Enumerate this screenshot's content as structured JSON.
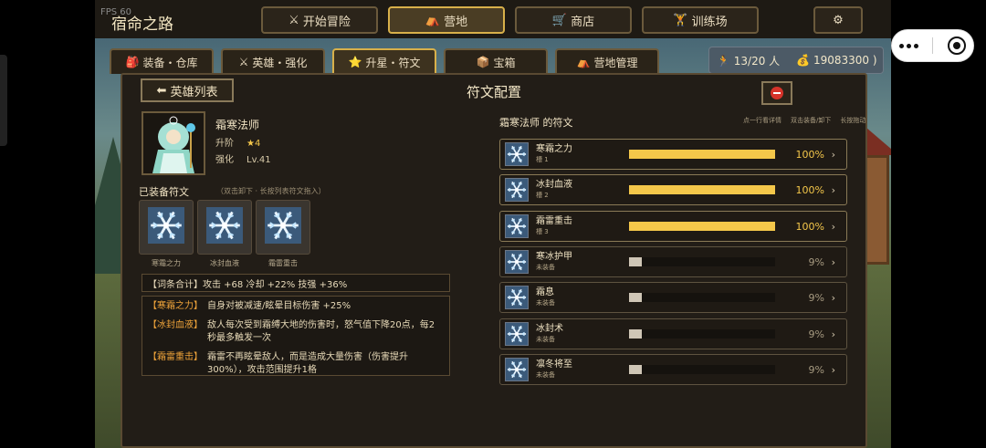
{
  "top_bar": {
    "fps": "FPS 60",
    "title": "宿命之路",
    "nav": [
      {
        "icon": "swords-icon",
        "glyph": "⚔",
        "label": "开始冒险",
        "active": false
      },
      {
        "icon": "camp-tent-icon",
        "glyph": "⛺",
        "label": "营地",
        "active": true
      },
      {
        "icon": "cart-icon",
        "glyph": "🛒",
        "label": "商店",
        "active": false
      },
      {
        "icon": "weightlifter-icon",
        "glyph": "🏋",
        "label": "训练场",
        "active": false
      }
    ],
    "settings_glyph": "⚙"
  },
  "tabs": [
    {
      "icon": "backpack-icon",
      "glyph": "🎒",
      "label": "装备・仓库",
      "active": false
    },
    {
      "icon": "swords-icon",
      "glyph": "⚔",
      "label": "英雄・强化",
      "active": false
    },
    {
      "icon": "star-upgrade-icon",
      "glyph": "⭐",
      "label": "升星・符文",
      "active": true
    },
    {
      "icon": "chest-icon",
      "glyph": "📦",
      "label": "宝箱",
      "active": false
    },
    {
      "icon": "camp-tent-icon",
      "glyph": "⛺",
      "label": "营地管理",
      "active": false
    }
  ],
  "status": {
    "people_glyph": "🏃",
    "people": "13/20 人",
    "gold_glyph": "💰",
    "gold": "19083300 )"
  },
  "panel": {
    "back_label": "英雄列表",
    "back_glyph": "⬅",
    "title": "符文配置",
    "hero": {
      "name": "霜寒法师",
      "rank_label": "升阶",
      "rank_value": "★4",
      "enhance_label": "强化",
      "enhance_value": "Lv.41"
    },
    "equipped": {
      "title": "已装备符文",
      "hint": "（双击卸下 · 长按列表符文拖入）",
      "slots": [
        {
          "label": "寒霜之力"
        },
        {
          "label": "冰封血液"
        },
        {
          "label": "霜雷重击"
        }
      ]
    },
    "summary": "【词条合计】攻击 +68    冷却 +22%    技强 +36%",
    "effects": [
      {
        "name": "【寒霜之力】",
        "text": "自身对被减速/眩晕目标伤害 +25%"
      },
      {
        "name": "【冰封血液】",
        "text": "敌人每次受到霜缚大地的伤害时，怒气值下降20点，每2秒最多触发一次"
      },
      {
        "name": "【霜雷重击】",
        "text": "霜雷不再眩晕敌人，而是造成大量伤害（伤害提升300%），攻击范围提升1格"
      }
    ],
    "rune_list": {
      "title": "霜寒法师 的符文",
      "hints": [
        "点一行看详情",
        "双击装备/卸下",
        "长按拖动"
      ],
      "items": [
        {
          "name": "寒霜之力",
          "sub": "槽 1",
          "pct": "100%",
          "fill": 1.0,
          "equipped": true
        },
        {
          "name": "冰封血液",
          "sub": "槽 2",
          "pct": "100%",
          "fill": 1.0,
          "equipped": true
        },
        {
          "name": "霜雷重击",
          "sub": "槽 3",
          "pct": "100%",
          "fill": 1.0,
          "equipped": true
        },
        {
          "name": "寒冰护甲",
          "sub": "未装备",
          "pct": "9%",
          "fill": 0.09,
          "equipped": false
        },
        {
          "name": "霜息",
          "sub": "未装备",
          "pct": "9%",
          "fill": 0.09,
          "equipped": false
        },
        {
          "name": "冰封术",
          "sub": "未装备",
          "pct": "9%",
          "fill": 0.09,
          "equipped": false
        },
        {
          "name": "凛冬将至",
          "sub": "未装备",
          "pct": "9%",
          "fill": 0.09,
          "equipped": false
        }
      ],
      "chevron": "›"
    }
  },
  "colors": {
    "accent_gold": "#f4c74a",
    "effect_name": "#f0a43a",
    "close_red": "#d6332a"
  }
}
